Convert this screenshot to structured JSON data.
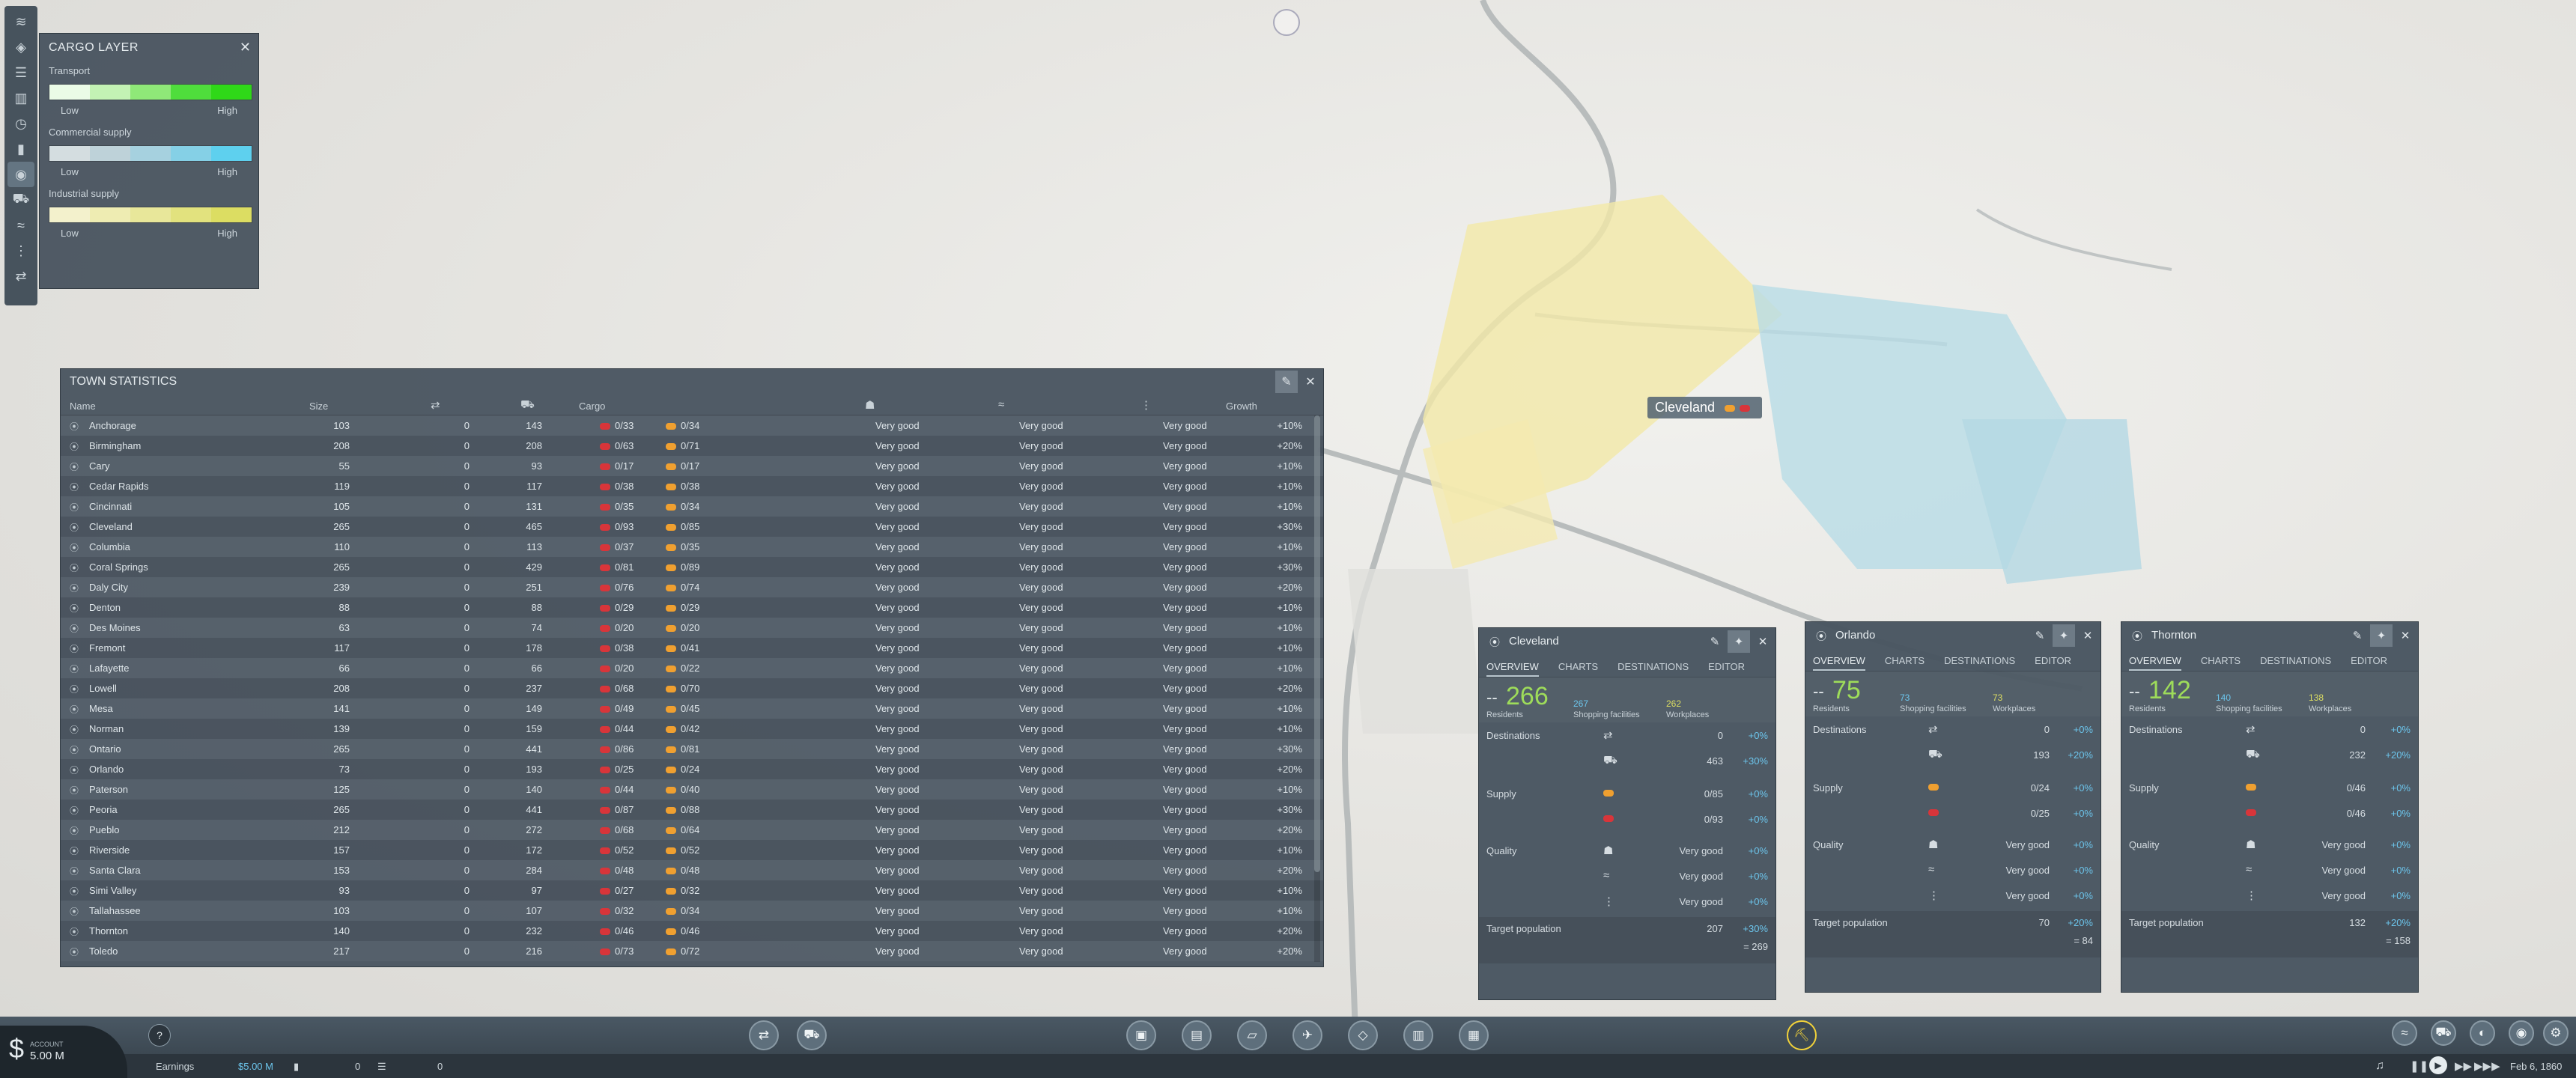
{
  "map": {
    "city_label": "Cleveland"
  },
  "cargo_layer": {
    "title": "CARGO LAYER",
    "legends": [
      {
        "label": "Transport",
        "low": "Low",
        "high": "High",
        "colors": [
          "#eafbe6",
          "#c3f2b4",
          "#8fe878",
          "#4fdd3c",
          "#2fd818"
        ]
      },
      {
        "label": "Commercial supply",
        "low": "Low",
        "high": "High",
        "colors": [
          "#d4dde0",
          "#bed2d9",
          "#a6d1df",
          "#85d0e6",
          "#5ed0ee"
        ]
      },
      {
        "label": "Industrial supply",
        "low": "Low",
        "high": "High",
        "colors": [
          "#f3f1cc",
          "#eeecb2",
          "#e8e79a",
          "#e2e27e",
          "#dcdd62"
        ]
      }
    ]
  },
  "town_stats": {
    "title": "TOWN STATISTICS",
    "columns": {
      "name": "Name",
      "size": "Size",
      "cargo": "Cargo",
      "growth": "Growth"
    },
    "rows": [
      {
        "name": "Anchorage",
        "size": "103",
        "dest": "0",
        "cars": "143",
        "c1": "0/33",
        "c2": "0/34",
        "q1": "Very good",
        "q2": "Very good",
        "q3": "Very good",
        "growth": "+10%"
      },
      {
        "name": "Birmingham",
        "size": "208",
        "dest": "0",
        "cars": "208",
        "c1": "0/63",
        "c2": "0/71",
        "q1": "Very good",
        "q2": "Very good",
        "q3": "Very good",
        "growth": "+20%"
      },
      {
        "name": "Cary",
        "size": "55",
        "dest": "0",
        "cars": "93",
        "c1": "0/17",
        "c2": "0/17",
        "q1": "Very good",
        "q2": "Very good",
        "q3": "Very good",
        "growth": "+10%"
      },
      {
        "name": "Cedar Rapids",
        "size": "119",
        "dest": "0",
        "cars": "117",
        "c1": "0/38",
        "c2": "0/38",
        "q1": "Very good",
        "q2": "Very good",
        "q3": "Very good",
        "growth": "+10%"
      },
      {
        "name": "Cincinnati",
        "size": "105",
        "dest": "0",
        "cars": "131",
        "c1": "0/35",
        "c2": "0/34",
        "q1": "Very good",
        "q2": "Very good",
        "q3": "Very good",
        "growth": "+10%"
      },
      {
        "name": "Cleveland",
        "size": "265",
        "dest": "0",
        "cars": "465",
        "c1": "0/93",
        "c2": "0/85",
        "q1": "Very good",
        "q2": "Very good",
        "q3": "Very good",
        "growth": "+30%"
      },
      {
        "name": "Columbia",
        "size": "110",
        "dest": "0",
        "cars": "113",
        "c1": "0/37",
        "c2": "0/35",
        "q1": "Very good",
        "q2": "Very good",
        "q3": "Very good",
        "growth": "+10%"
      },
      {
        "name": "Coral Springs",
        "size": "265",
        "dest": "0",
        "cars": "429",
        "c1": "0/81",
        "c2": "0/89",
        "q1": "Very good",
        "q2": "Very good",
        "q3": "Very good",
        "growth": "+30%"
      },
      {
        "name": "Daly City",
        "size": "239",
        "dest": "0",
        "cars": "251",
        "c1": "0/76",
        "c2": "0/74",
        "q1": "Very good",
        "q2": "Very good",
        "q3": "Very good",
        "growth": "+20%"
      },
      {
        "name": "Denton",
        "size": "88",
        "dest": "0",
        "cars": "88",
        "c1": "0/29",
        "c2": "0/29",
        "q1": "Very good",
        "q2": "Very good",
        "q3": "Very good",
        "growth": "+10%"
      },
      {
        "name": "Des Moines",
        "size": "63",
        "dest": "0",
        "cars": "74",
        "c1": "0/20",
        "c2": "0/20",
        "q1": "Very good",
        "q2": "Very good",
        "q3": "Very good",
        "growth": "+10%"
      },
      {
        "name": "Fremont",
        "size": "117",
        "dest": "0",
        "cars": "178",
        "c1": "0/38",
        "c2": "0/41",
        "q1": "Very good",
        "q2": "Very good",
        "q3": "Very good",
        "growth": "+10%"
      },
      {
        "name": "Lafayette",
        "size": "66",
        "dest": "0",
        "cars": "66",
        "c1": "0/20",
        "c2": "0/22",
        "q1": "Very good",
        "q2": "Very good",
        "q3": "Very good",
        "growth": "+10%"
      },
      {
        "name": "Lowell",
        "size": "208",
        "dest": "0",
        "cars": "237",
        "c1": "0/68",
        "c2": "0/70",
        "q1": "Very good",
        "q2": "Very good",
        "q3": "Very good",
        "growth": "+20%"
      },
      {
        "name": "Mesa",
        "size": "141",
        "dest": "0",
        "cars": "149",
        "c1": "0/49",
        "c2": "0/45",
        "q1": "Very good",
        "q2": "Very good",
        "q3": "Very good",
        "growth": "+10%"
      },
      {
        "name": "Norman",
        "size": "139",
        "dest": "0",
        "cars": "159",
        "c1": "0/44",
        "c2": "0/42",
        "q1": "Very good",
        "q2": "Very good",
        "q3": "Very good",
        "growth": "+10%"
      },
      {
        "name": "Ontario",
        "size": "265",
        "dest": "0",
        "cars": "441",
        "c1": "0/86",
        "c2": "0/81",
        "q1": "Very good",
        "q2": "Very good",
        "q3": "Very good",
        "growth": "+30%"
      },
      {
        "name": "Orlando",
        "size": "73",
        "dest": "0",
        "cars": "193",
        "c1": "0/25",
        "c2": "0/24",
        "q1": "Very good",
        "q2": "Very good",
        "q3": "Very good",
        "growth": "+20%"
      },
      {
        "name": "Paterson",
        "size": "125",
        "dest": "0",
        "cars": "140",
        "c1": "0/44",
        "c2": "0/40",
        "q1": "Very good",
        "q2": "Very good",
        "q3": "Very good",
        "growth": "+10%"
      },
      {
        "name": "Peoria",
        "size": "265",
        "dest": "0",
        "cars": "441",
        "c1": "0/87",
        "c2": "0/88",
        "q1": "Very good",
        "q2": "Very good",
        "q3": "Very good",
        "growth": "+30%"
      },
      {
        "name": "Pueblo",
        "size": "212",
        "dest": "0",
        "cars": "272",
        "c1": "0/68",
        "c2": "0/64",
        "q1": "Very good",
        "q2": "Very good",
        "q3": "Very good",
        "growth": "+20%"
      },
      {
        "name": "Riverside",
        "size": "157",
        "dest": "0",
        "cars": "172",
        "c1": "0/52",
        "c2": "0/52",
        "q1": "Very good",
        "q2": "Very good",
        "q3": "Very good",
        "growth": "+10%"
      },
      {
        "name": "Santa Clara",
        "size": "153",
        "dest": "0",
        "cars": "284",
        "c1": "0/48",
        "c2": "0/48",
        "q1": "Very good",
        "q2": "Very good",
        "q3": "Very good",
        "growth": "+20%"
      },
      {
        "name": "Simi Valley",
        "size": "93",
        "dest": "0",
        "cars": "97",
        "c1": "0/27",
        "c2": "0/32",
        "q1": "Very good",
        "q2": "Very good",
        "q3": "Very good",
        "growth": "+10%"
      },
      {
        "name": "Tallahassee",
        "size": "103",
        "dest": "0",
        "cars": "107",
        "c1": "0/32",
        "c2": "0/34",
        "q1": "Very good",
        "q2": "Very good",
        "q3": "Very good",
        "growth": "+10%"
      },
      {
        "name": "Thornton",
        "size": "140",
        "dest": "0",
        "cars": "232",
        "c1": "0/46",
        "c2": "0/46",
        "q1": "Very good",
        "q2": "Very good",
        "q3": "Very good",
        "growth": "+20%"
      },
      {
        "name": "Toledo",
        "size": "217",
        "dest": "0",
        "cars": "216",
        "c1": "0/73",
        "c2": "0/72",
        "q1": "Very good",
        "q2": "Very good",
        "q3": "Very good",
        "growth": "+20%"
      }
    ]
  },
  "town_windows": [
    {
      "name": "Cleveland",
      "tabs": [
        "OVERVIEW",
        "CHARTS",
        "DESTINATIONS",
        "EDITOR"
      ],
      "residents": "266",
      "residents_label": "Residents",
      "shopping": "267",
      "shopping_label": "Shopping facilities",
      "workplaces": "262",
      "workplaces_label": "Workplaces",
      "destinations_label": "Destinations",
      "dest_vals": [
        "0",
        "463"
      ],
      "dest_pcts": [
        "+0%",
        "+30%"
      ],
      "supply_label": "Supply",
      "supply_vals": [
        "0/85",
        "0/93"
      ],
      "supply_pcts": [
        "+0%",
        "+0%"
      ],
      "quality_label": "Quality",
      "quality_vals": [
        "Very good",
        "Very good",
        "Very good"
      ],
      "quality_pcts": [
        "+0%",
        "+0%",
        "+0%"
      ],
      "target_label": "Target population",
      "target_val": "207",
      "target_pct": "+30%",
      "target_total": "= 269"
    },
    {
      "name": "Orlando",
      "tabs": [
        "OVERVIEW",
        "CHARTS",
        "DESTINATIONS",
        "EDITOR"
      ],
      "residents": "75",
      "residents_label": "Residents",
      "shopping": "73",
      "shopping_label": "Shopping facilities",
      "workplaces": "73",
      "workplaces_label": "Workplaces",
      "destinations_label": "Destinations",
      "dest_vals": [
        "0",
        "193"
      ],
      "dest_pcts": [
        "+0%",
        "+20%"
      ],
      "supply_label": "Supply",
      "supply_vals": [
        "0/24",
        "0/25"
      ],
      "supply_pcts": [
        "+0%",
        "+0%"
      ],
      "quality_label": "Quality",
      "quality_vals": [
        "Very good",
        "Very good",
        "Very good"
      ],
      "quality_pcts": [
        "+0%",
        "+0%",
        "+0%"
      ],
      "target_label": "Target population",
      "target_val": "70",
      "target_pct": "+20%",
      "target_total": "= 84"
    },
    {
      "name": "Thornton",
      "tabs": [
        "OVERVIEW",
        "CHARTS",
        "DESTINATIONS",
        "EDITOR"
      ],
      "residents": "142",
      "residents_label": "Residents",
      "shopping": "140",
      "shopping_label": "Shopping facilities",
      "workplaces": "138",
      "workplaces_label": "Workplaces",
      "destinations_label": "Destinations",
      "dest_vals": [
        "0",
        "232"
      ],
      "dest_pcts": [
        "+0%",
        "+20%"
      ],
      "supply_label": "Supply",
      "supply_vals": [
        "0/46",
        "0/46"
      ],
      "supply_pcts": [
        "+0%",
        "+0%"
      ],
      "quality_label": "Quality",
      "quality_vals": [
        "Very good",
        "Very good",
        "Very good"
      ],
      "quality_pcts": [
        "+0%",
        "+0%",
        "+0%"
      ],
      "target_label": "Target population",
      "target_val": "132",
      "target_pct": "+20%",
      "target_total": "= 158"
    }
  ],
  "account": {
    "label": "ACCOUNT",
    "value": "5.00 M"
  },
  "status": {
    "earnings_label": "Earnings",
    "earnings_value": "$5.00 M",
    "count_a": "0",
    "count_b": "0",
    "date": "Feb 6, 1860"
  }
}
